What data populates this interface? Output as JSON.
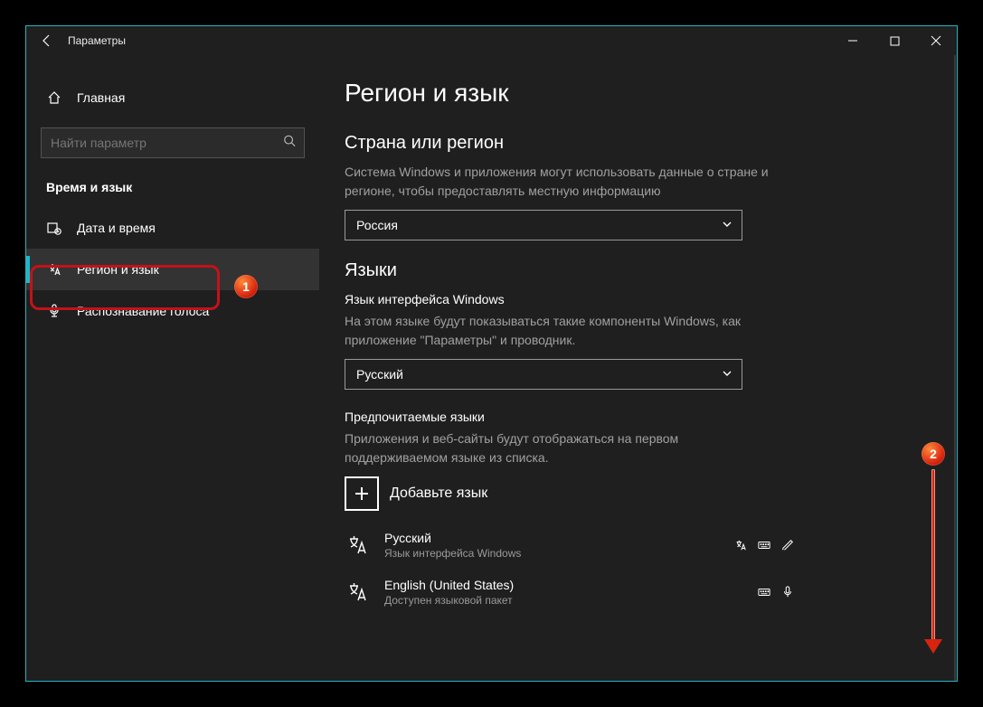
{
  "window": {
    "title": "Параметры"
  },
  "sidebar": {
    "home": "Главная",
    "search_placeholder": "Найти параметр",
    "section": "Время и язык",
    "items": [
      {
        "label": "Дата и время"
      },
      {
        "label": "Регион и язык"
      },
      {
        "label": "Распознавание голоса"
      }
    ],
    "active_index": 1
  },
  "content": {
    "page_title": "Регион и язык",
    "region": {
      "heading": "Страна или регион",
      "desc": "Система Windows и приложения могут использовать данные о стране и регионе, чтобы предоставлять местную информацию",
      "value": "Россия"
    },
    "languages": {
      "heading": "Языки",
      "display_lang_sub": "Язык интерфейса Windows",
      "display_lang_desc": "На этом языке будут показываться такие компоненты Windows, как приложение \"Параметры\" и проводник.",
      "display_lang_value": "Русский",
      "preferred_sub": "Предпочитаемые языки",
      "preferred_desc": "Приложения и веб-сайты будут отображаться на первом поддерживаемом языке из списка.",
      "add_label": "Добавьте язык",
      "list": [
        {
          "name": "Русский",
          "sub": "Язык интерфейса Windows",
          "features": [
            "display",
            "keyboard",
            "handwriting"
          ]
        },
        {
          "name": "English (United States)",
          "sub": "Доступен языковой пакет",
          "features": [
            "keyboard",
            "speech"
          ]
        }
      ]
    }
  },
  "annotations": {
    "badge1": "1",
    "badge2": "2"
  }
}
